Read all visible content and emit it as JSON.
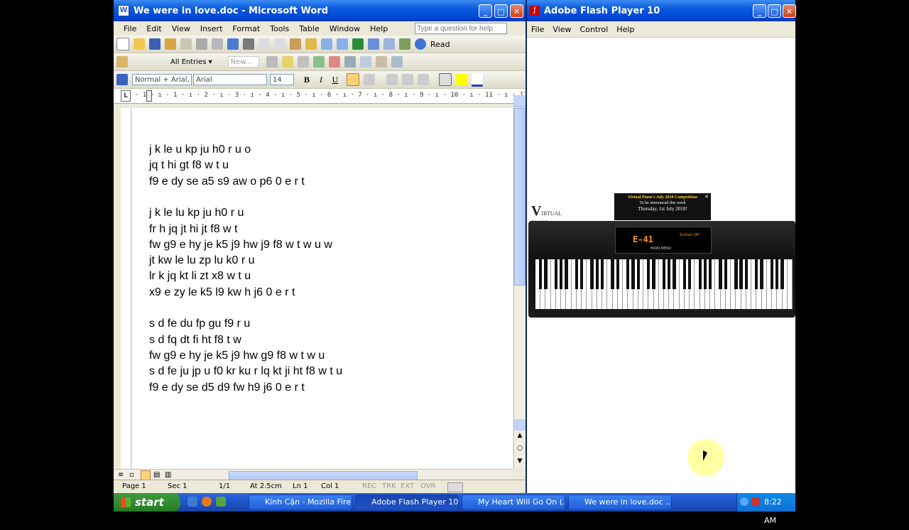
{
  "word": {
    "title": "We were in love.doc - Microsoft Word",
    "menu": [
      "File",
      "Edit",
      "View",
      "Insert",
      "Format",
      "Tools",
      "Table",
      "Window",
      "Help"
    ],
    "help_placeholder": "Type a question for help",
    "entries_label": "All Entries ▾",
    "new_label": "New...",
    "read_label": "Read",
    "style_value": "Normal + Arial,",
    "font_value": "Arial",
    "size_value": "14",
    "bold": "B",
    "italic": "I",
    "underline": "U",
    "ruler_numbers": "· 1 · ı · 1 · ı · 2 · ı · 3 · ı · 4 · ı · 5 · ı · 6 · ı · 7 · ı · 8 · ı · 9 · ı · 10 · ı · 11 · ı · 12 · ı · 1",
    "lines": [
      "j k le u kp ju h0 r u o",
      "jq t hi gt f8 w t u",
      "f9 e dy se a5 s9 aw o p6 0 e r t",
      "",
      "j k le lu kp ju h0 r u",
      "fr h jq jt hi jt f8 w t",
      "fw g9 e hy je k5 j9 hw j9 f8 w t w u w",
      "jt kw le lu zp lu k0 r u",
      "lr k jq kt li zt x8 w t u",
      "x9 e zy le k5 l9 kw h j6 0 e r t",
      "",
      "s d fe du fp gu f9 r u",
      "s d fq dt fi ht f8 t w",
      "fw g9 e hy je k5 j9 hw g9 f8 w t w u",
      "s d fe ju jp u f0 kr ku r lq kt ji ht f8 w t u",
      "f9 e dy se d5 d9 fw h9 j6 0 e r t"
    ],
    "status": {
      "page": "Page  1",
      "sec": "Sec  1",
      "pages": "1/1",
      "at": "At  2.5cm",
      "ln": "Ln  1",
      "col": "Col  1",
      "rec": "REC",
      "trk": "TRK",
      "ext": "EXT",
      "ovr": "OVR"
    }
  },
  "flash": {
    "title": "Adobe Flash Player 10",
    "menu": [
      "File",
      "View",
      "Control",
      "Help"
    ],
    "banner_title": "Virtual Piano's July 2010 Competition",
    "banner_sub": "To be announced this week",
    "banner_date": "Thursday, 1st July 2010!",
    "display": "E-41",
    "display_small": "Sustain Off",
    "main_menu": "MAIN MENU",
    "logo_text": "IRTUAL PIANO"
  },
  "taskbar": {
    "start": "start",
    "tasks": [
      "Kinh Cận - Mozilla Fire...",
      "Adobe Flash Player 10",
      "My Heart Will Go On (...",
      "We were in love.doc ..."
    ],
    "time": "8:22 AM"
  },
  "colors": {
    "xp_blue": "#0046d6",
    "taskbar": "#245edb",
    "start_green": "#2f8a2f",
    "cursor_highlight": "#ffff99"
  }
}
